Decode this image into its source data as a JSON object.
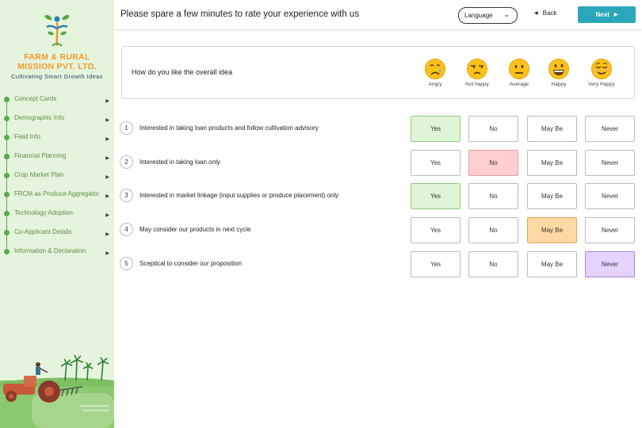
{
  "sidebar": {
    "brand_line1": "FARM & RURAL",
    "brand_line2": "MISSION PVT. LTD.",
    "tagline": "Cultivating Smart Growth Ideas",
    "items": [
      {
        "label": "Concept Cards"
      },
      {
        "label": "Demographic Info"
      },
      {
        "label": "Field Info"
      },
      {
        "label": "Financial Planning"
      },
      {
        "label": "Crop Market Plan"
      },
      {
        "label": "FRCM as Produce Aggregator"
      },
      {
        "label": "Technology Adoption"
      },
      {
        "label": "Co-Applicant Details"
      },
      {
        "label": "Information & Declaration"
      }
    ]
  },
  "header": {
    "title": "Please spare a few minutes to rate your experience with us",
    "language_label": "Language",
    "back_label": "Back",
    "next_label": "Next"
  },
  "rating": {
    "question": "How do you like the overall idea",
    "options": [
      {
        "label": "Angry",
        "icon": "crying-face-icon"
      },
      {
        "label": "Not happy",
        "icon": "unamused-face-icon"
      },
      {
        "label": "Average",
        "icon": "neutral-face-icon"
      },
      {
        "label": "Happy",
        "icon": "grinning-face-icon"
      },
      {
        "label": "Very Happy",
        "icon": "relieved-face-icon"
      }
    ]
  },
  "answer_labels": [
    "Yes",
    "No",
    "May Be",
    "Never"
  ],
  "questions": [
    {
      "num": "1",
      "text": "Interested in taking loan products and follow cultivation advisory",
      "selected": "Yes"
    },
    {
      "num": "2",
      "text": "Interested in taking loan only",
      "selected": "No"
    },
    {
      "num": "3",
      "text": "Interested in market linkage (input supplies or produce placement) only",
      "selected": "Yes"
    },
    {
      "num": "4",
      "text": "May consider our products in next cycle",
      "selected": "May Be"
    },
    {
      "num": "5",
      "text": "Sceptical to consider our proposition",
      "selected": "Never"
    }
  ],
  "colors": {
    "accent": "#2ba7bb",
    "brand": "#f2992e",
    "sidebar_bg": "#e5f4dc",
    "yes_selected": "#dff5d7",
    "no_selected": "#ffcfcf",
    "maybe_selected": "#ffd9a3",
    "never_selected": "#e6d2ff"
  }
}
